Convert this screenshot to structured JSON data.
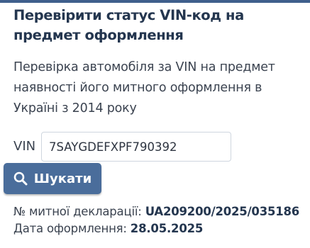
{
  "header": {
    "title": "Перевірити статус VIN-код на предмет оформлення"
  },
  "description": "Перевірка автомобіля за VIN на предмет наявності його митного оформлення в Україні з 2014 року",
  "form": {
    "vin_label": "VIN",
    "vin_value": "7SAYGDEFXPF790392",
    "search_label": "Шукати",
    "search_icon": "search-icon"
  },
  "result": {
    "declaration_label": "№ митної декларації:",
    "declaration_value": "UA209200/2025/035186",
    "date_label": "Дата оформлення:",
    "date_value": "28.05.2025"
  },
  "colors": {
    "accent": "#4a6d9b",
    "title_text": "#24364f",
    "body_text": "#3b4350"
  }
}
